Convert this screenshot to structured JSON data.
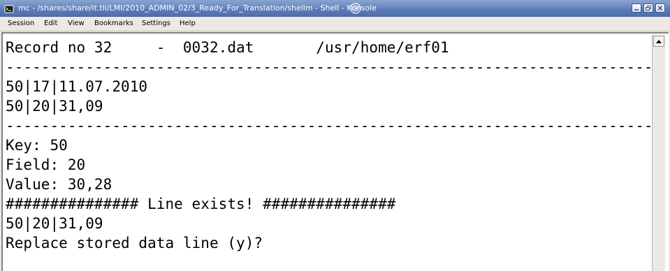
{
  "window": {
    "title": "mc - /shares/share/it.tli/LMI/2010_ADMIN_02/3_Ready_For_Translation/shellm - Shell - Konsole"
  },
  "menubar": {
    "items": [
      "Session",
      "Edit",
      "View",
      "Bookmarks",
      "Settings",
      "Help"
    ]
  },
  "terminal": {
    "lines": [
      "Record no 32     -  0032.dat       /usr/home/erf01",
      "--------------------------------------------------------------------------------",
      "50|17|11.07.2010",
      "50|20|31,09",
      "--------------------------------------------------------------------------------",
      "Key: 50",
      "Field: 20",
      "Value: 30,28",
      "############### Line exists! ###############",
      "50|20|31,09",
      "Replace stored data line (y)?"
    ]
  },
  "icons": {
    "app": "konsole-icon",
    "swirl": "kde-swirl-icon",
    "minimize": "minimize-icon",
    "maximize": "maximize-icon",
    "close": "close-icon",
    "scroll_up": "scroll-up-arrow-icon"
  },
  "colors": {
    "titlebar": "#5a7bb8",
    "terminal_bg": "#ffffff",
    "terminal_fg": "#000000"
  }
}
